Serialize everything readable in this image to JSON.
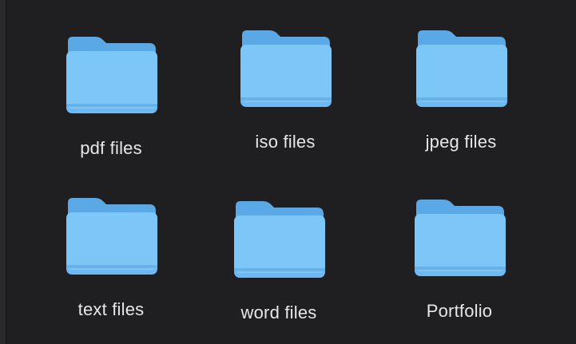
{
  "folder_icon": "folder-icon",
  "colors": {
    "background": "#1f1f21",
    "folder_back": "#5aa8e6",
    "folder_front": "#7dc7f8",
    "label": "#e7e7ea"
  },
  "folders": [
    {
      "label": "pdf files"
    },
    {
      "label": "iso files"
    },
    {
      "label": "jpeg files"
    },
    {
      "label": "text files"
    },
    {
      "label": "word files"
    },
    {
      "label": "Portfolio"
    }
  ]
}
